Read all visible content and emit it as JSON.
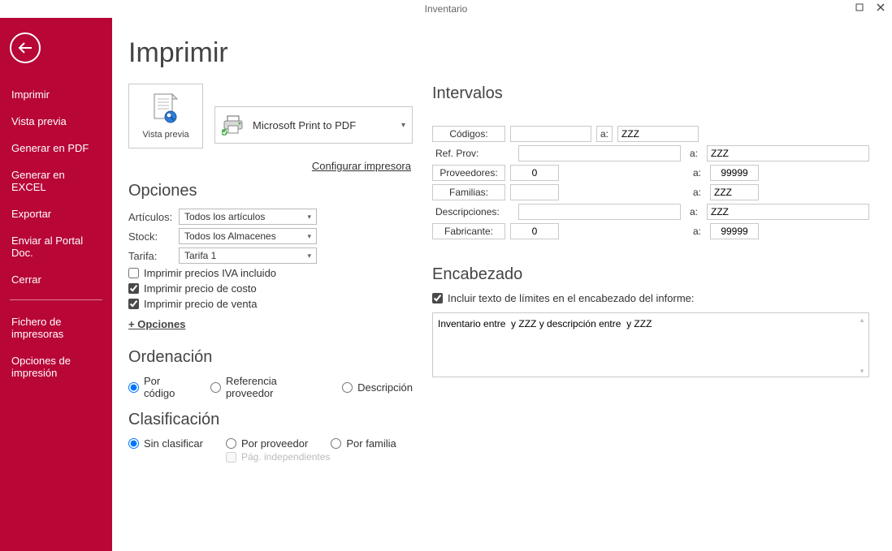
{
  "title": "Inventario",
  "sidebar": {
    "items": [
      "Imprimir",
      "Vista previa",
      "Generar en PDF",
      "Generar en EXCEL",
      "Exportar",
      "Enviar al Portal Doc.",
      "Cerrar"
    ],
    "extra": [
      "Fichero de impresoras",
      "Opciones de impresión"
    ]
  },
  "header": "Imprimir",
  "preview_label": "Vista previa",
  "printer_name": "Microsoft Print to PDF",
  "cfg_link": "Configurar impresora",
  "options": {
    "heading": "Opciones",
    "rows": [
      {
        "label": "Artículos:",
        "value": "Todos los artículos"
      },
      {
        "label": "Stock:",
        "value": "Todos los Almacenes"
      },
      {
        "label": "Tarifa:",
        "value": "Tarifa 1"
      }
    ],
    "checks": [
      {
        "label": "Imprimir precios IVA incluido",
        "checked": false
      },
      {
        "label": "Imprimir precio de costo",
        "checked": true
      },
      {
        "label": "Imprimir precio de venta",
        "checked": true
      }
    ],
    "more": "+ Opciones"
  },
  "ordering": {
    "heading": "Ordenación",
    "opts": [
      "Por código",
      "Referencia proveedor",
      "Descripción"
    ],
    "sel": 0
  },
  "classification": {
    "heading": "Clasificación",
    "opts": [
      "Sin clasificar",
      "Por proveedor",
      "Por familia"
    ],
    "sel": 0,
    "sub": "Pág. independientes"
  },
  "intervals": {
    "heading": "Intervalos",
    "a": "a:",
    "rows": [
      {
        "label": "Códigos:",
        "boxed": true,
        "from": "",
        "to": "ZZZ",
        "wide_from": 100,
        "wide_to": 100,
        "mid_spacer": 0
      },
      {
        "label": "Ref. Prov:",
        "boxed": false,
        "from": "",
        "to": "ZZZ",
        "wide_from": 200,
        "wide_to": 200,
        "mid_spacer": 0,
        "plain_a": true
      },
      {
        "label": "Proveedores:",
        "boxed": true,
        "from": "0",
        "to": "99999",
        "wide_from": 60,
        "wide_to": 60,
        "num": true,
        "mid_spacer": 148,
        "plain_a": true
      },
      {
        "label": "Familias:",
        "boxed": true,
        "from": "",
        "to": "ZZZ",
        "wide_from": 60,
        "wide_to": 60,
        "mid_spacer": 148,
        "plain_a": true
      },
      {
        "label": "Descripciones:",
        "boxed": false,
        "from": "",
        "to": "ZZZ",
        "wide_from": 200,
        "wide_to": 200,
        "mid_spacer": 0,
        "plain_a": true
      },
      {
        "label": "Fabricante:",
        "boxed": true,
        "from": "0",
        "to": "99999",
        "wide_from": 60,
        "wide_to": 60,
        "num": true,
        "mid_spacer": 148,
        "plain_a": true
      }
    ]
  },
  "enc": {
    "heading": "Encabezado",
    "check": "Incluir texto de límites en el encabezado del informe:",
    "text": "Inventario entre  y ZZZ y descripción entre  y ZZZ"
  }
}
